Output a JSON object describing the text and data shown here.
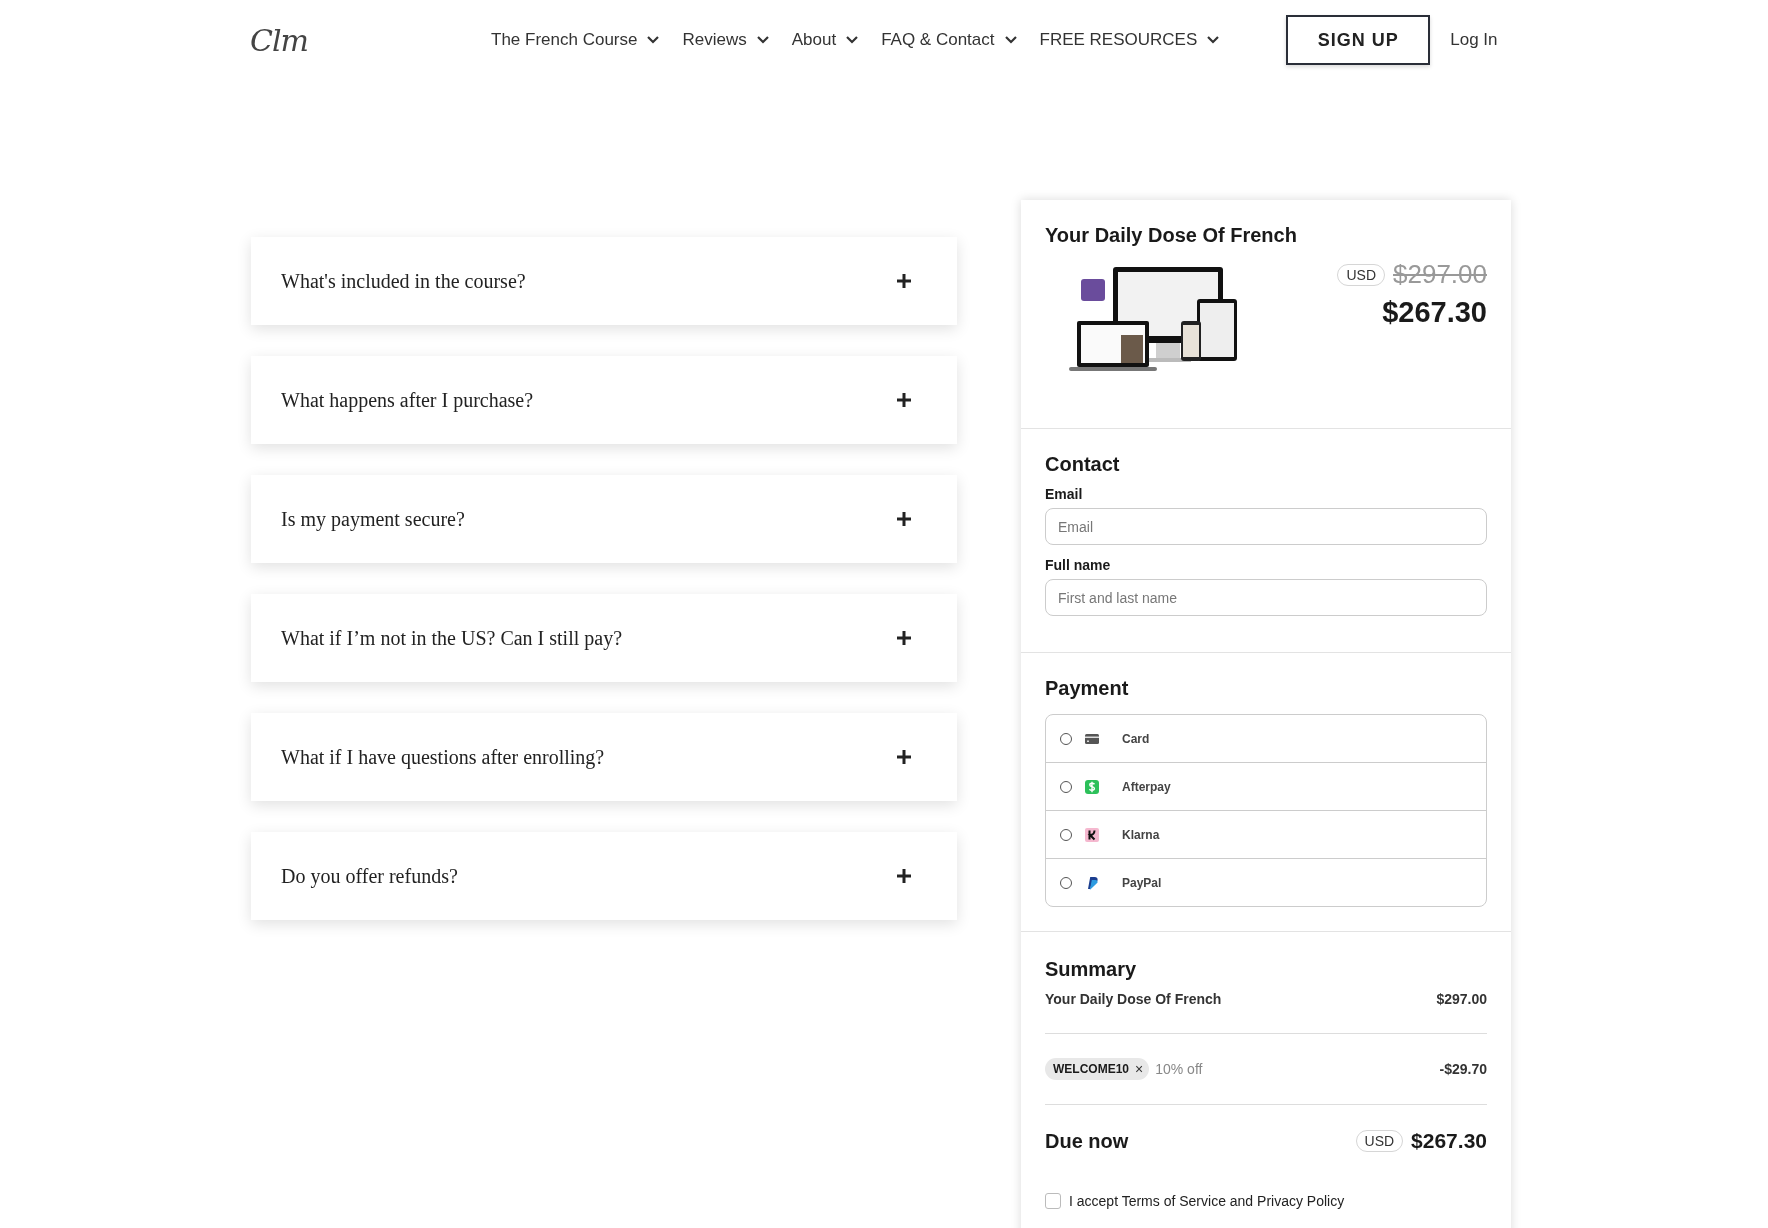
{
  "header": {
    "logo": "Clm",
    "nav": [
      {
        "label": "The French Course",
        "has_menu": true
      },
      {
        "label": "Reviews",
        "has_menu": true
      },
      {
        "label": "About",
        "has_menu": true
      },
      {
        "label": "FAQ & Contact",
        "has_menu": true
      },
      {
        "label": "FREE RESOURCES",
        "has_menu": true
      }
    ],
    "signup": "SIGN UP",
    "login": "Log In"
  },
  "faq": [
    {
      "question": "What's included in the course?",
      "expanded": false
    },
    {
      "question": "What happens after I purchase?",
      "expanded": false
    },
    {
      "question": "Is my payment secure?",
      "expanded": false
    },
    {
      "question": "What if I’m not in the US? Can I still pay?",
      "expanded": false
    },
    {
      "question": "What if I have questions after enrolling?",
      "expanded": false
    },
    {
      "question": "Do you offer refunds?",
      "expanded": false
    }
  ],
  "checkout": {
    "product": {
      "title": "Your Daily Dose Of French",
      "currency": "USD",
      "old_price": "$297.00",
      "price": "$267.30"
    },
    "contact": {
      "title": "Contact",
      "fields": [
        {
          "label": "Email",
          "placeholder": "Email"
        },
        {
          "label": "Full name",
          "placeholder": "First and last name"
        }
      ]
    },
    "payment": {
      "title": "Payment",
      "methods": [
        {
          "kind": "card",
          "label": "Card",
          "selected": false
        },
        {
          "kind": "afterpay",
          "label": "Afterpay",
          "selected": false
        },
        {
          "kind": "klarna",
          "label": "Klarna",
          "selected": false
        },
        {
          "kind": "paypal",
          "label": "PayPal",
          "selected": false
        }
      ]
    },
    "summary": {
      "title": "Summary",
      "item": "Your Daily Dose Of French",
      "item_price": "$297.00",
      "coupon": "WELCOME10",
      "coupon_remove": "×",
      "discount_note": "10% off",
      "discount": "-$29.70",
      "due_label": "Due now",
      "due_currency": "USD",
      "due_amount": "$267.30"
    },
    "terms": {
      "label": "I accept Terms of Service and Privacy Policy",
      "checked": false
    }
  }
}
